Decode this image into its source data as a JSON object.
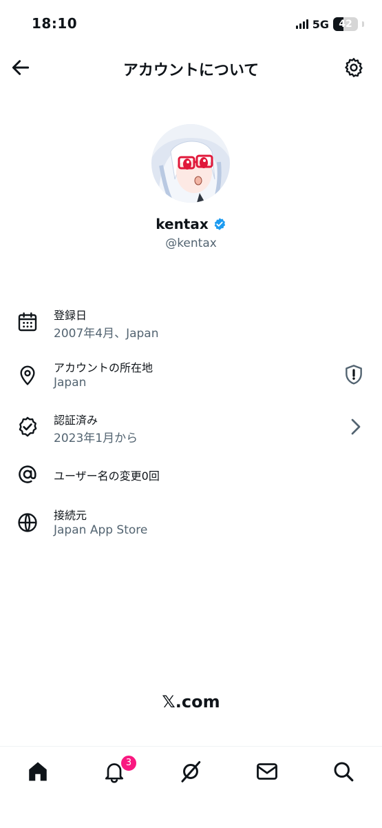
{
  "status_bar": {
    "time": "18:10",
    "network": "5G",
    "battery": "42"
  },
  "header": {
    "title": "アカウントについて"
  },
  "profile": {
    "display_name": "kentax",
    "handle": "@kentax"
  },
  "info_rows": [
    {
      "icon": "calendar-icon",
      "label": "登録日",
      "value": "2007年4月、Japan"
    },
    {
      "icon": "location-pin-icon",
      "label": "アカウントの所在地",
      "value": "Japan",
      "action_icon": "shield-alert-icon"
    },
    {
      "icon": "verified-badge-icon",
      "label": "認証済み",
      "value": "2023年1月から",
      "action_icon": "chevron-right-icon"
    },
    {
      "icon": "at-sign-icon",
      "label": "ユーザー名の変更0回"
    },
    {
      "icon": "globe-icon",
      "label": "接続元",
      "value": "Japan App Store"
    }
  ],
  "footer": {
    "brand": "𝕏.com"
  },
  "tab_bar": {
    "tabs": [
      "home-icon",
      "notifications-icon",
      "grok-icon",
      "messages-icon",
      "search-icon"
    ],
    "notification_badge": "3"
  },
  "colors": {
    "verified": "#1d9bf0",
    "badge": "#f91880",
    "secondary_text": "#536471"
  }
}
